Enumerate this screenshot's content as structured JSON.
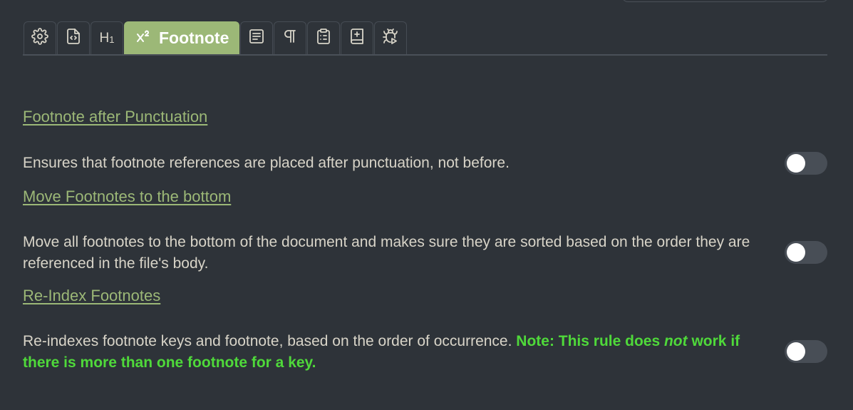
{
  "tabs": [
    {
      "icon": "gear-icon"
    },
    {
      "icon": "code-file-icon"
    },
    {
      "label": "H",
      "sub": "1"
    },
    {
      "icon": "superscript-icon",
      "label": "Footnote",
      "active": true
    },
    {
      "icon": "text-block-icon"
    },
    {
      "icon": "pilcrow-icon"
    },
    {
      "icon": "clipboard-list-icon"
    },
    {
      "icon": "add-document-icon"
    },
    {
      "icon": "bug-icon"
    }
  ],
  "rules": [
    {
      "title": "Footnote after Punctuation",
      "description": "Ensures that footnote references are placed after punctuation, not before.",
      "enabled": false
    },
    {
      "title": "Move Footnotes to the bottom",
      "description": "Move all footnotes to the bottom of the document and makes sure they are sorted based on the order they are referenced in the file's body.",
      "enabled": false
    },
    {
      "title": "Re-Index Footnotes",
      "description": "Re-indexes footnote keys and footnote, based on the order of occurrence.",
      "note_prefix": "Note: This rule does ",
      "note_emph": "not",
      "note_suffix": " work if there is more than one footnote for a key.",
      "enabled": false
    }
  ]
}
